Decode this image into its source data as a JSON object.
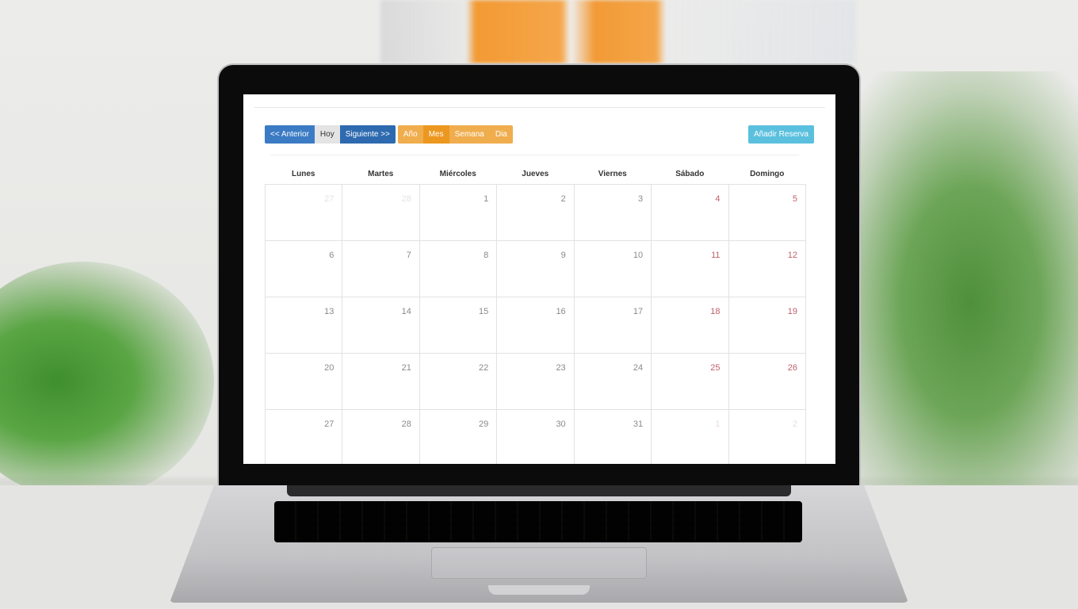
{
  "toolbar": {
    "prev_label": "<< Anterior",
    "today_label": "Hoy",
    "next_label": "Siguiente >>",
    "views": [
      {
        "label": "Año",
        "active": false
      },
      {
        "label": "Mes",
        "active": true
      },
      {
        "label": "Semana",
        "active": false
      },
      {
        "label": "Dia",
        "active": false
      }
    ],
    "add_label": "Añadir Reserva"
  },
  "calendar": {
    "weekdays": [
      "Lunes",
      "Martes",
      "Miércoles",
      "Jueves",
      "Viernes",
      "Sábado",
      "Domingo"
    ],
    "weeks": [
      [
        {
          "d": "27",
          "muted": true
        },
        {
          "d": "28",
          "muted": true
        },
        {
          "d": "1"
        },
        {
          "d": "2"
        },
        {
          "d": "3"
        },
        {
          "d": "4",
          "weekend": true
        },
        {
          "d": "5",
          "weekend": true
        }
      ],
      [
        {
          "d": "6"
        },
        {
          "d": "7"
        },
        {
          "d": "8"
        },
        {
          "d": "9"
        },
        {
          "d": "10"
        },
        {
          "d": "11",
          "weekend": true
        },
        {
          "d": "12",
          "weekend": true
        }
      ],
      [
        {
          "d": "13"
        },
        {
          "d": "14"
        },
        {
          "d": "15"
        },
        {
          "d": "16"
        },
        {
          "d": "17"
        },
        {
          "d": "18",
          "weekend": true
        },
        {
          "d": "19",
          "weekend": true
        }
      ],
      [
        {
          "d": "20"
        },
        {
          "d": "21"
        },
        {
          "d": "22"
        },
        {
          "d": "23"
        },
        {
          "d": "24"
        },
        {
          "d": "25",
          "weekend": true
        },
        {
          "d": "26",
          "weekend": true
        }
      ],
      [
        {
          "d": "27"
        },
        {
          "d": "28"
        },
        {
          "d": "29"
        },
        {
          "d": "30"
        },
        {
          "d": "31"
        },
        {
          "d": "1",
          "muted": true,
          "weekend": true
        },
        {
          "d": "2",
          "muted": true,
          "weekend": true
        }
      ]
    ]
  },
  "colors": {
    "primary": "#3b7bc4",
    "warning": "#f0ad4e",
    "info": "#5bc0de",
    "weekend": "#c0606a"
  }
}
